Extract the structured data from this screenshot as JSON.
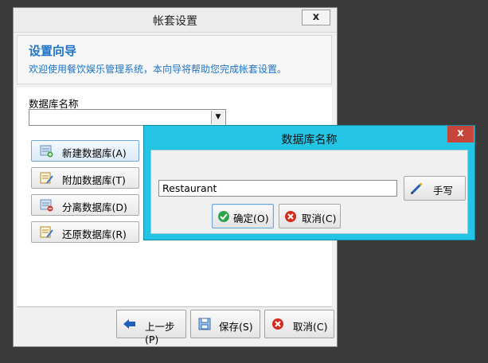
{
  "main_window": {
    "title": "帐套设置",
    "close_label": "x",
    "header": {
      "title": "设置向导",
      "subtitle": "欢迎使用餐饮娱乐管理系统，本向导将帮助您完成帐套设置。"
    },
    "db_name_label": "数据库名称",
    "db_name_value": "",
    "action_buttons": [
      {
        "label": "新建数据库(A)",
        "icon": "db-new-icon"
      },
      {
        "label": "附加数据库(T)",
        "icon": "db-attach-icon"
      },
      {
        "label": "分离数据库(D)",
        "icon": "db-detach-icon"
      },
      {
        "label": "还原数据库(R)",
        "icon": "db-restore-icon"
      }
    ],
    "bottom_buttons": {
      "prev": "上一步(P)",
      "save": "保存(S)",
      "cancel": "取消(C)"
    }
  },
  "dialog": {
    "title": "数据库名称",
    "close_label": "x",
    "input_value": "Restaurant",
    "handwrite_label": "手写",
    "ok_label": "确定(O)",
    "cancel_label": "取消(C)"
  },
  "colors": {
    "dialog_frame": "#24c4e4",
    "header_text": "#1e73c8",
    "close_red": "#c7463b"
  }
}
